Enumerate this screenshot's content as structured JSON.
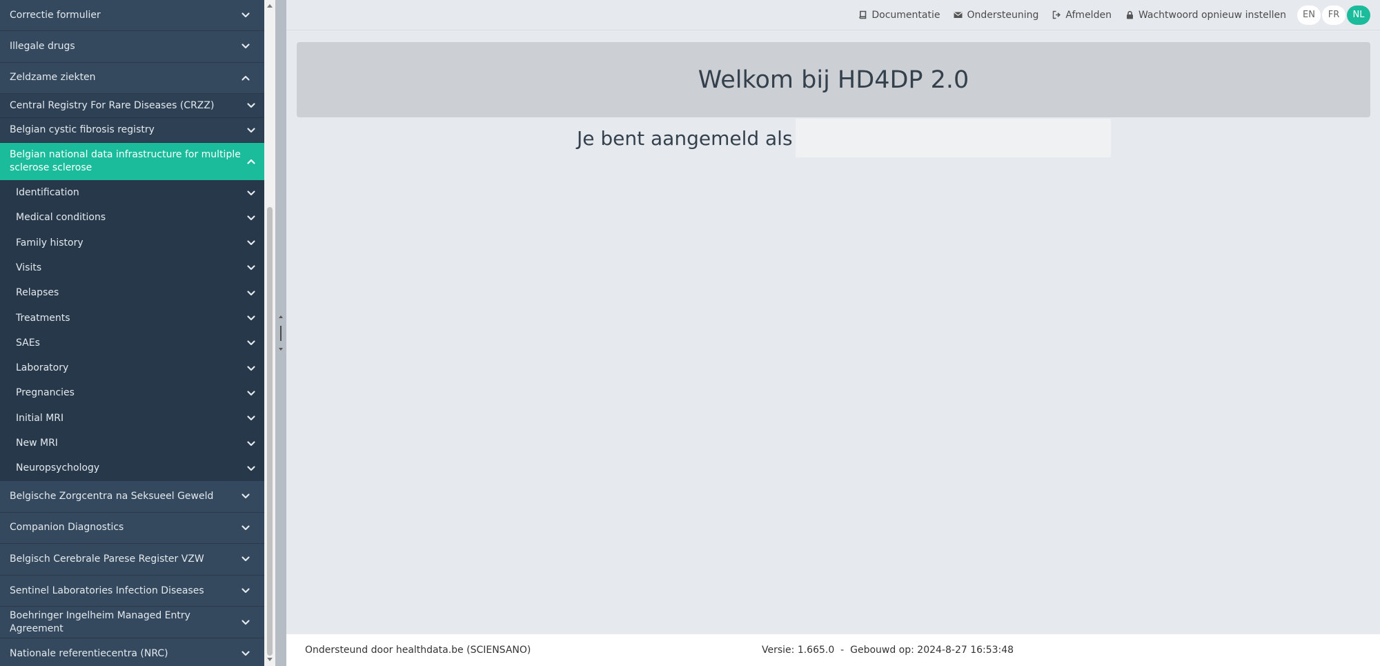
{
  "sidebar": {
    "top_before": [
      {
        "label": "Correctie formulier",
        "expanded": false
      },
      {
        "label": "Illegale drugs",
        "expanded": false
      },
      {
        "label": "Zeldzame ziekten",
        "expanded": true
      }
    ],
    "registries": [
      {
        "label": "Central Registry For Rare Diseases (CRZZ)",
        "active": false
      },
      {
        "label": "Belgian cystic fibrosis registry",
        "active": false
      },
      {
        "label": "Belgian national data infrastructure for multiple sclerose sclerose",
        "active": true
      }
    ],
    "sections": [
      {
        "label": "Identification"
      },
      {
        "label": "Medical conditions"
      },
      {
        "label": "Family history"
      },
      {
        "label": "Visits"
      },
      {
        "label": "Relapses"
      },
      {
        "label": "Treatments"
      },
      {
        "label": "SAEs"
      },
      {
        "label": "Laboratory"
      },
      {
        "label": "Pregnancies"
      },
      {
        "label": "Initial MRI"
      },
      {
        "label": "New MRI"
      },
      {
        "label": "Neuropsychology"
      }
    ],
    "top_after": [
      {
        "label": "Belgische Zorgcentra na Seksueel Geweld"
      },
      {
        "label": "Companion Diagnostics"
      },
      {
        "label": "Belgisch Cerebrale Parese Register VZW"
      },
      {
        "label": "Sentinel Laboratories Infection Diseases"
      },
      {
        "label": "Boehringer Ingelheim Managed Entry Agreement"
      },
      {
        "label": "Nationale referentiecentra (NRC)"
      }
    ]
  },
  "topbar": {
    "links": [
      {
        "label": "Documentatie",
        "icon": "book-icon"
      },
      {
        "label": "Ondersteuning",
        "icon": "envelope-icon"
      },
      {
        "label": "Afmelden",
        "icon": "sign-out-icon"
      },
      {
        "label": "Wachtwoord opnieuw instellen",
        "icon": "lock-icon"
      }
    ],
    "languages": [
      {
        "code": "EN",
        "active": false
      },
      {
        "code": "FR",
        "active": false
      },
      {
        "code": "NL",
        "active": true
      }
    ]
  },
  "main": {
    "welcome_title": "Welkom bij HD4DP 2.0",
    "logged_in_label": "Je bent aangemeld als",
    "logged_in_user": ""
  },
  "footer": {
    "supported_by": "Ondersteund door healthdata.be (SCIENSANO)",
    "version_build": "Versie: 1.665.0  -  Gebouwd op: 2024-8-27 16:53:48"
  },
  "colors": {
    "sidebar_bg": "#2c3e50",
    "accent": "#1abc9c",
    "main_bg": "#e6eaee"
  }
}
